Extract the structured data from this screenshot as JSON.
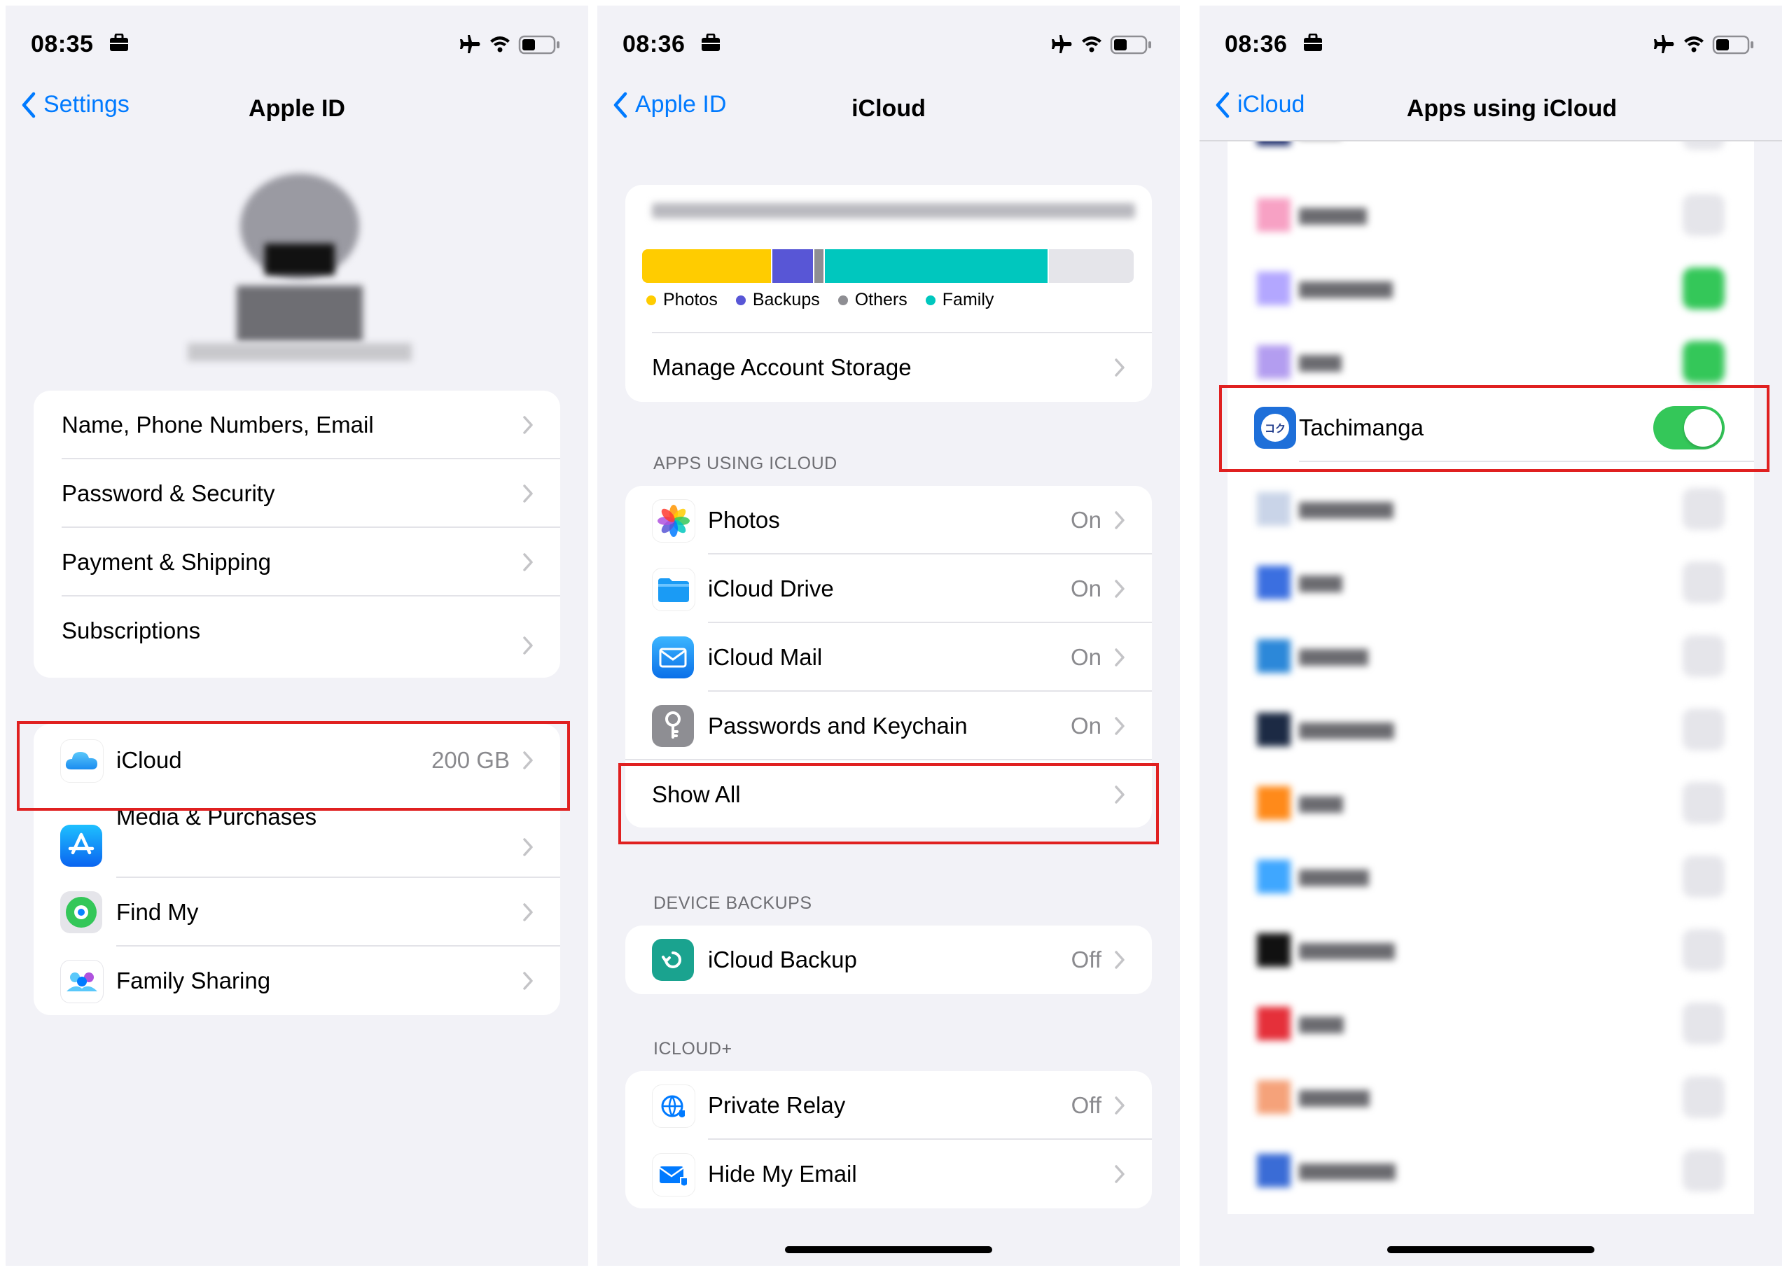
{
  "screen1": {
    "time": "08:35",
    "back_label": "Settings",
    "title": "Apple ID",
    "rows_group1": [
      "Name, Phone Numbers, Email",
      "Password & Security",
      "Payment & Shipping",
      "Subscriptions"
    ],
    "icloud": {
      "label": "iCloud",
      "value": "200 GB"
    },
    "media_label": "Media & Purchases",
    "findmy_label": "Find My",
    "family_label": "Family Sharing"
  },
  "screen2": {
    "time": "08:36",
    "back_label": "Apple ID",
    "title": "iCloud",
    "storage": {
      "legend": [
        "Photos",
        "Backups",
        "Others",
        "Family"
      ],
      "colors": [
        "#ffcc00",
        "#5856d6",
        "#8e8e93",
        "#00c7be"
      ],
      "fractions": [
        0.265,
        0.085,
        0.022,
        0.455
      ],
      "manage_label": "Manage Account Storage"
    },
    "apps_header": "APPS USING ICLOUD",
    "apps": [
      {
        "label": "Photos",
        "value": "On",
        "icon": "photos-icon"
      },
      {
        "label": "iCloud Drive",
        "value": "On",
        "icon": "folder-icon"
      },
      {
        "label": "iCloud Mail",
        "value": "On",
        "icon": "mail-icon"
      },
      {
        "label": "Passwords and Keychain",
        "value": "On",
        "icon": "key-icon"
      }
    ],
    "show_all": "Show All",
    "backups_header": "DEVICE BACKUPS",
    "backup": {
      "label": "iCloud Backup",
      "value": "Off"
    },
    "plus_header": "ICLOUD+",
    "relay": {
      "label": "Private Relay",
      "value": "Off"
    },
    "hide_email": {
      "label": "Hide My Email"
    }
  },
  "screen3": {
    "time": "08:36",
    "back_label": "iCloud",
    "title": "Apps using iCloud",
    "highlighted_app": {
      "label": "Tachimanga",
      "icon_text": "コク",
      "toggle": "on"
    }
  },
  "colors": {
    "accent": "#007aff",
    "toggle_on": "#34c759",
    "highlight": "#e02020",
    "background": "#f2f2f7"
  }
}
